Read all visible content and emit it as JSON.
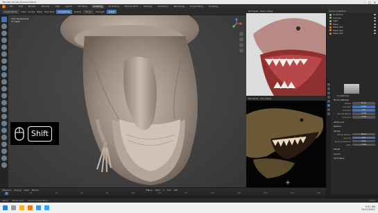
{
  "titlebar": {
    "title": "Blender [Sculpt_Dinosaur.blend]",
    "min": "–",
    "max": "□",
    "close": "✕"
  },
  "menubar": {
    "menus": [
      "File",
      "Edit",
      "Render",
      "Window",
      "Help"
    ],
    "workspaces": [
      "Layout",
      "Modeling",
      "Sculpting",
      "UV Editing",
      "Texture Paint",
      "Shading",
      "Animation",
      "Rendering",
      "Compositing",
      "Scripting"
    ],
    "active_workspace": "Sculpting"
  },
  "viewport_header": {
    "mode": "Sculpt Mode",
    "menus": [
      "View",
      "Sculpt",
      "Mask",
      "Face Sets"
    ],
    "brush": "SculptDraw",
    "radius_label": "Radius",
    "strength_label": "Strength"
  },
  "viewport_info": {
    "view": "User Perspective",
    "object": "(1) Mesh"
  },
  "key_overlay": {
    "key": "Shift"
  },
  "reference_top": {
    "header": "Not Inputs · shark_ref.jpg"
  },
  "reference_bottom": {
    "header": "Not Inputs · trex_ref.jpg"
  },
  "outliner": {
    "title": "Scene Collection",
    "rows": [
      {
        "label": "Collection",
        "kind": "w"
      },
      {
        "label": "Camera",
        "kind": "g"
      },
      {
        "label": "Light",
        "kind": "g"
      },
      {
        "label": "Mesh",
        "kind": "o"
      },
      {
        "label": "Mesh.001",
        "kind": "o"
      },
      {
        "label": "Mesh.002",
        "kind": "o"
      },
      {
        "label": "Mesh.003",
        "kind": "o"
      }
    ]
  },
  "properties": {
    "brush_name": "SculptDraw",
    "panel_brush": "Brush Settings",
    "rows": [
      {
        "label": "Radius",
        "value": "50 px",
        "blue": false
      },
      {
        "label": "Strength",
        "value": "0.500",
        "blue": true
      },
      {
        "label": "Direction",
        "value": "Add",
        "blue": true
      },
      {
        "label": "Normal Radius",
        "value": "0.500",
        "blue": false
      },
      {
        "label": "Hardness",
        "value": "0.000",
        "blue": false
      }
    ],
    "panel_advanced": "Advanced",
    "panel_texture": "Texture",
    "panel_stroke": "Stroke",
    "stroke_rows": [
      {
        "label": "Stroke Method",
        "value": "Space",
        "blue": false
      },
      {
        "label": "Spacing",
        "value": "10%",
        "blue": true
      },
      {
        "label": "Spacing Distance",
        "value": "View",
        "blue": false
      },
      {
        "label": "Jitter",
        "value": "0.000",
        "blue": false
      }
    ],
    "panel_falloff": "Falloff",
    "panel_cursor": "Cursor",
    "panel_symmetry": "Symmetry"
  },
  "timeline": {
    "menus": [
      "Playback",
      "Keying",
      "View",
      "Marker"
    ],
    "current_frame": "1",
    "ticks": [
      "0",
      "20",
      "40",
      "60",
      "80",
      "100",
      "120",
      "140",
      "160",
      "180",
      "200",
      "220",
      "240"
    ],
    "start_label": "Start",
    "start": "1",
    "end_label": "End",
    "end": "250"
  },
  "statusbar": {
    "items": [
      "Select",
      "Rotate View",
      "Sculpt Context Menu"
    ],
    "version": "2.93.0"
  },
  "taskbar": {
    "time": "9:41 AM",
    "date": "10/12/2021"
  },
  "colors": {
    "accent": "#4772b3",
    "brand": "#e87d0d",
    "bg": "#1d1d1d"
  }
}
